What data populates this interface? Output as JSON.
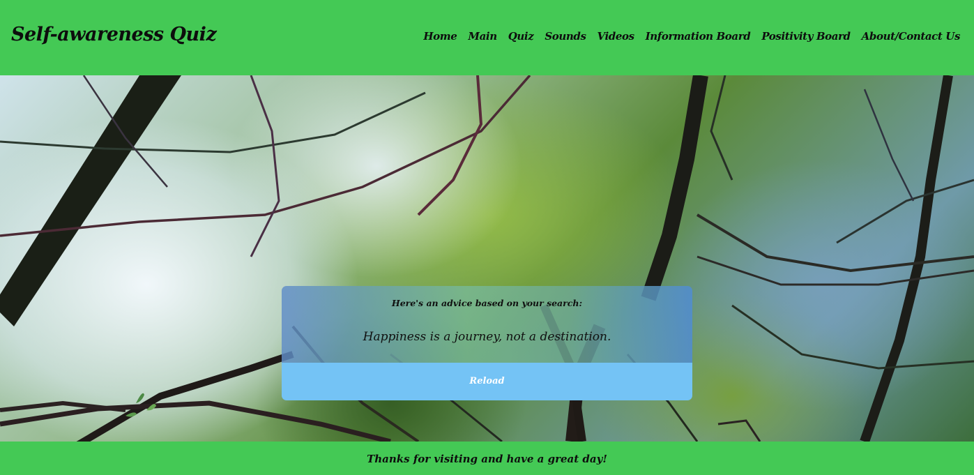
{
  "header": {
    "title": "Self-awareness Quiz",
    "nav": [
      "Home",
      "Main",
      "Quiz",
      "Sounds",
      "Videos",
      "Information Board",
      "Positivity Board",
      "About/Contact Us"
    ]
  },
  "advice": {
    "heading": "Here's an advice based on your search:",
    "text": "Happiness is a journey, not a destination.",
    "reload_label": "Reload"
  },
  "footer": {
    "text": "Thanks for visiting and have a great day!"
  },
  "colors": {
    "header_bg": "#44c955",
    "button_bg": "#74c3f5"
  }
}
